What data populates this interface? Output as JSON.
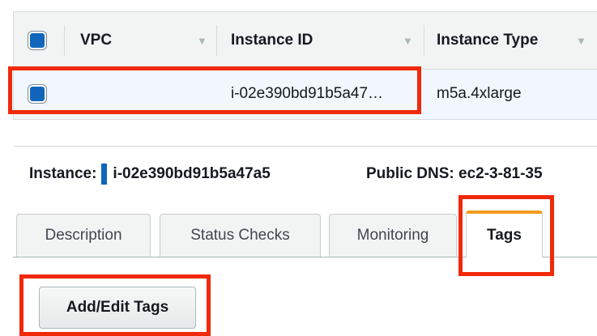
{
  "table": {
    "columns": [
      {
        "label": "VPC"
      },
      {
        "label": "Instance ID"
      },
      {
        "label": "Instance Type"
      }
    ],
    "row": {
      "vpc": "",
      "instance_id": "i-02e390bd91b5a47…",
      "instance_type": "m5a.4xlarge",
      "selected": true
    }
  },
  "details": {
    "instance_label": "Instance:",
    "instance_id": "i-02e390bd91b5a47a5",
    "public_dns_label": "Public DNS:",
    "public_dns_value": "ec2-3-81-35"
  },
  "tabs": [
    {
      "label": "Description",
      "active": false
    },
    {
      "label": "Status Checks",
      "active": false
    },
    {
      "label": "Monitoring",
      "active": false
    },
    {
      "label": "Tags",
      "active": true
    }
  ],
  "tags_panel": {
    "add_edit_label": "Add/Edit Tags"
  },
  "colors": {
    "highlight": "#f0290a",
    "active_tab_accent": "#f29a1d",
    "checkbox": "#1166bb",
    "selected_row": "#f1f7fd"
  },
  "icons": [
    "checkbox-icon",
    "sort-caret-icon",
    "instance-id-marker-icon"
  ]
}
